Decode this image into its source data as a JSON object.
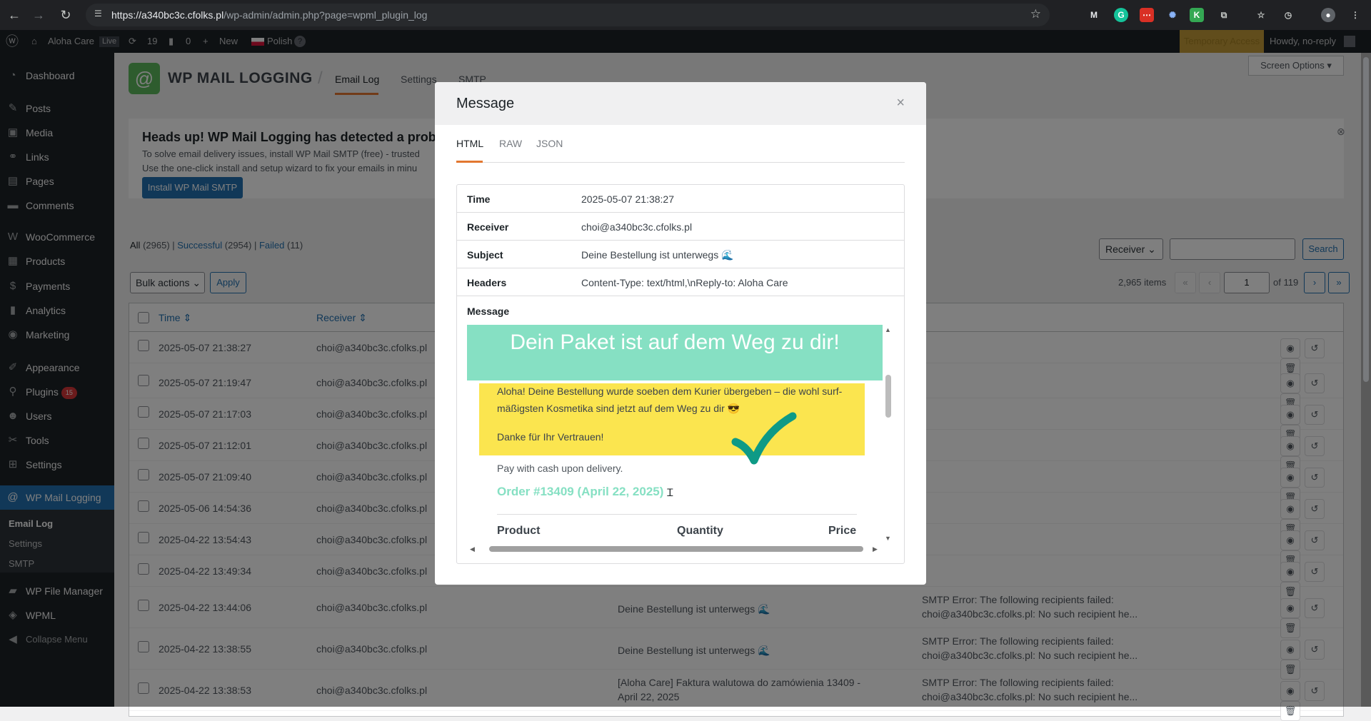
{
  "browser": {
    "url_host": "https://a340bc3c.cfolks.pl",
    "url_path": "/wp-admin/admin.php?page=wpml_plugin_log"
  },
  "adminbar": {
    "site_name": "Aloha Care",
    "live": "Live",
    "updates": "19",
    "comments": "0",
    "new": "New",
    "language": "Polish",
    "temporary_access": "Temporary Access",
    "howdy": "Howdy, no-reply"
  },
  "sidebar": {
    "items": [
      {
        "label": "Dashboard",
        "icon": "dashboard-icon"
      },
      {
        "label": "Posts",
        "icon": "pin-icon"
      },
      {
        "label": "Media",
        "icon": "media-icon"
      },
      {
        "label": "Links",
        "icon": "link-icon"
      },
      {
        "label": "Pages",
        "icon": "page-icon"
      },
      {
        "label": "Comments",
        "icon": "comment-icon"
      },
      {
        "label": "WooCommerce",
        "icon": "woo-icon"
      },
      {
        "label": "Products",
        "icon": "box-icon"
      },
      {
        "label": "Payments",
        "icon": "dollar-icon"
      },
      {
        "label": "Analytics",
        "icon": "chart-icon"
      },
      {
        "label": "Marketing",
        "icon": "megaphone-icon"
      },
      {
        "label": "Appearance",
        "icon": "brush-icon"
      },
      {
        "label": "Plugins",
        "icon": "plug-icon",
        "badge": "15"
      },
      {
        "label": "Users",
        "icon": "user-icon"
      },
      {
        "label": "Tools",
        "icon": "wrench-icon"
      },
      {
        "label": "Settings",
        "icon": "settings-icon"
      },
      {
        "label": "WP Mail Logging",
        "icon": "at-icon"
      },
      {
        "label": "WP File Manager",
        "icon": "folder-icon"
      },
      {
        "label": "WPML",
        "icon": "wpml-icon"
      },
      {
        "label": "Collapse Menu",
        "icon": "collapse-icon"
      }
    ],
    "submenu": [
      "Email Log",
      "Settings",
      "SMTP"
    ]
  },
  "plugin": {
    "title": "WP MAIL LOGGING",
    "tabs": [
      "Email Log",
      "Settings",
      "SMTP"
    ],
    "screen_options": "Screen Options ▾"
  },
  "notice": {
    "heading": "Heads up! WP Mail Logging has detected a problem",
    "line1": "To solve email delivery issues, install WP Mail SMTP (free) - trusted",
    "line2": "Use the one-click install and setup wizard to fix your emails in minu",
    "button": "Install WP Mail SMTP"
  },
  "filters": {
    "all": "All",
    "all_count": "(2965)",
    "successful": "Successful",
    "successful_count": "(2954)",
    "failed": "Failed",
    "failed_count": "(11)",
    "bulk_actions": "Bulk actions",
    "apply": "Apply",
    "search_field": "Receiver",
    "search_button": "Search",
    "items_count": "2,965 items",
    "page_current": "1",
    "page_total": "of 119"
  },
  "table": {
    "headers": {
      "time": "Time",
      "receiver": "Receiver"
    },
    "rows": [
      {
        "time": "2025-05-07 21:38:27",
        "receiver": "choi@a340bc3c.cfolks.pl",
        "subject": "",
        "error": ""
      },
      {
        "time": "2025-05-07 21:19:47",
        "receiver": "choi@a340bc3c.cfolks.pl",
        "subject": "",
        "error": ""
      },
      {
        "time": "2025-05-07 21:17:03",
        "receiver": "choi@a340bc3c.cfolks.pl",
        "subject": "",
        "error": ""
      },
      {
        "time": "2025-05-07 21:12:01",
        "receiver": "choi@a340bc3c.cfolks.pl",
        "subject": "",
        "error": ""
      },
      {
        "time": "2025-05-07 21:09:40",
        "receiver": "choi@a340bc3c.cfolks.pl",
        "subject": "",
        "error": ""
      },
      {
        "time": "2025-05-06 14:54:36",
        "receiver": "choi@a340bc3c.cfolks.pl",
        "subject": "",
        "error": ""
      },
      {
        "time": "2025-04-22 13:54:43",
        "receiver": "choi@a340bc3c.cfolks.pl",
        "subject": "",
        "error": ""
      },
      {
        "time": "2025-04-22 13:49:34",
        "receiver": "choi@a340bc3c.cfolks.pl",
        "subject": "",
        "error": ""
      },
      {
        "time": "2025-04-22 13:44:06",
        "receiver": "choi@a340bc3c.cfolks.pl",
        "subject": "Deine Bestellung ist unterwegs 🌊",
        "error": "SMTP Error: The following recipients failed: choi@a340bc3c.cfolks.pl: No such recipient he..."
      },
      {
        "time": "2025-04-22 13:38:55",
        "receiver": "choi@a340bc3c.cfolks.pl",
        "subject": "Deine Bestellung ist unterwegs 🌊",
        "error": "SMTP Error: The following recipients failed: choi@a340bc3c.cfolks.pl: No such recipient he..."
      },
      {
        "time": "2025-04-22 13:38:53",
        "receiver": "choi@a340bc3c.cfolks.pl",
        "subject": "[Aloha Care] Faktura walutowa do zamówienia 13409 - April 22, 2025",
        "error": "SMTP Error: The following recipients failed: choi@a340bc3c.cfolks.pl: No such recipient he..."
      }
    ]
  },
  "modal": {
    "title": "Message",
    "close": "×",
    "tabs": [
      "HTML",
      "RAW",
      "JSON"
    ],
    "fields": [
      {
        "label": "Time",
        "value": "2025-05-07 21:38:27"
      },
      {
        "label": "Receiver",
        "value": "choi@a340bc3c.cfolks.pl"
      },
      {
        "label": "Subject",
        "value": "Deine Bestellung ist unterwegs 🌊"
      },
      {
        "label": "Headers",
        "value": "Content-Type: text/html,\\nReply-to: Aloha Care"
      }
    ],
    "message_label": "Message",
    "email": {
      "banner": "Dein Paket ist auf dem Weg zu dir!",
      "para1_line1": "Aloha! Deine Bestellung wurde soeben dem Kurier übergeben – die wohl surf-",
      "para1_line2": "mäßigsten Kosmetika sind jetzt auf dem Weg zu dir 😎",
      "thanks": "Danke für Ihr Vertrauen!",
      "payment": "Pay with cash upon delivery.",
      "order": "Order #13409 (April 22, 2025)",
      "col_product": "Product",
      "col_quantity": "Quantity",
      "col_price": "Price"
    }
  },
  "colors": {
    "wp_blue": "#2271b1",
    "sidebar_bg": "#1d2327",
    "banner_teal": "#86e0c3",
    "yellow_box": "#fbe54f",
    "check_teal": "#0e9a86",
    "tab_accent": "#e27730"
  }
}
